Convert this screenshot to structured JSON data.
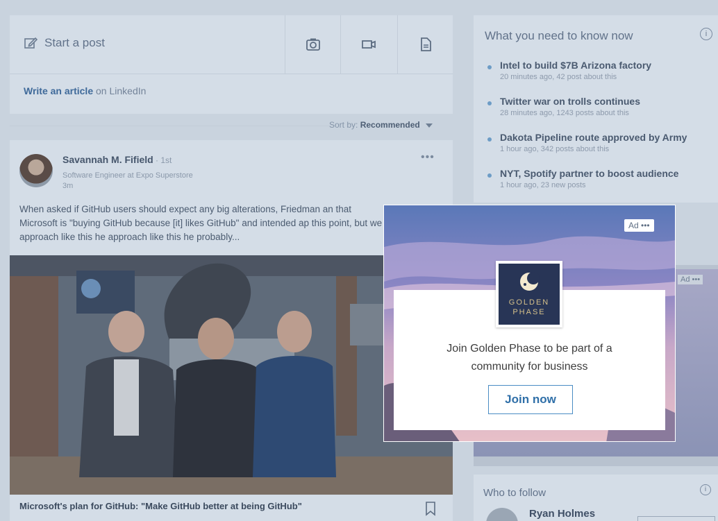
{
  "composer": {
    "start_post": "Start a post",
    "write_article_link": "Write an article",
    "write_article_rest": " on LinkedIn"
  },
  "feed": {
    "sort_label": "Sort by: ",
    "sort_value": "Recommended"
  },
  "post": {
    "author": "Savannah M. Fifield",
    "degree": " · 1st",
    "headline": "Software Engineer at Expo Superstore",
    "time": "3m",
    "more": "•••",
    "text": "When asked if GitHub users should expect any big alterations, Friedman an that Microsoft is \"buying GitHub because [it] likes GitHub\" and intended ap this point, but we approach like this he approach like this he probably...",
    "caption": "Microsoft's plan for GitHub: \"Make GitHub better at being GitHub\""
  },
  "news": {
    "title": "What you need to know now",
    "info": "i",
    "items": [
      {
        "headline": "Intel to build $7B Arizona factory",
        "meta": "20 minutes ago, 42 post about this"
      },
      {
        "headline": "Twitter war on trolls continues",
        "meta": "28 minutes ago, 1243 posts about this"
      },
      {
        "headline": "Dakota Pipeline route approved by Army",
        "meta": "1 hour ago, 342 posts about this"
      },
      {
        "headline": "NYT, Spotify partner to boost audience",
        "meta": "1 hour ago, 23 new posts"
      }
    ]
  },
  "side_ad": {
    "label": "Ad •••"
  },
  "follow": {
    "title": "Who to follow",
    "info": "i",
    "name": "Ryan Holmes"
  },
  "ad": {
    "badge": "Ad •••",
    "brand_line1": "GOLDEN",
    "brand_line2": "PHASE",
    "text": "Join Golden Phase to be part of a community for business",
    "cta": "Join now"
  },
  "colors": {
    "accent": "#2f6fa8",
    "overlay": "#c9d3de",
    "logo_bg": "#283556",
    "logo_gold": "#d5c08a"
  }
}
